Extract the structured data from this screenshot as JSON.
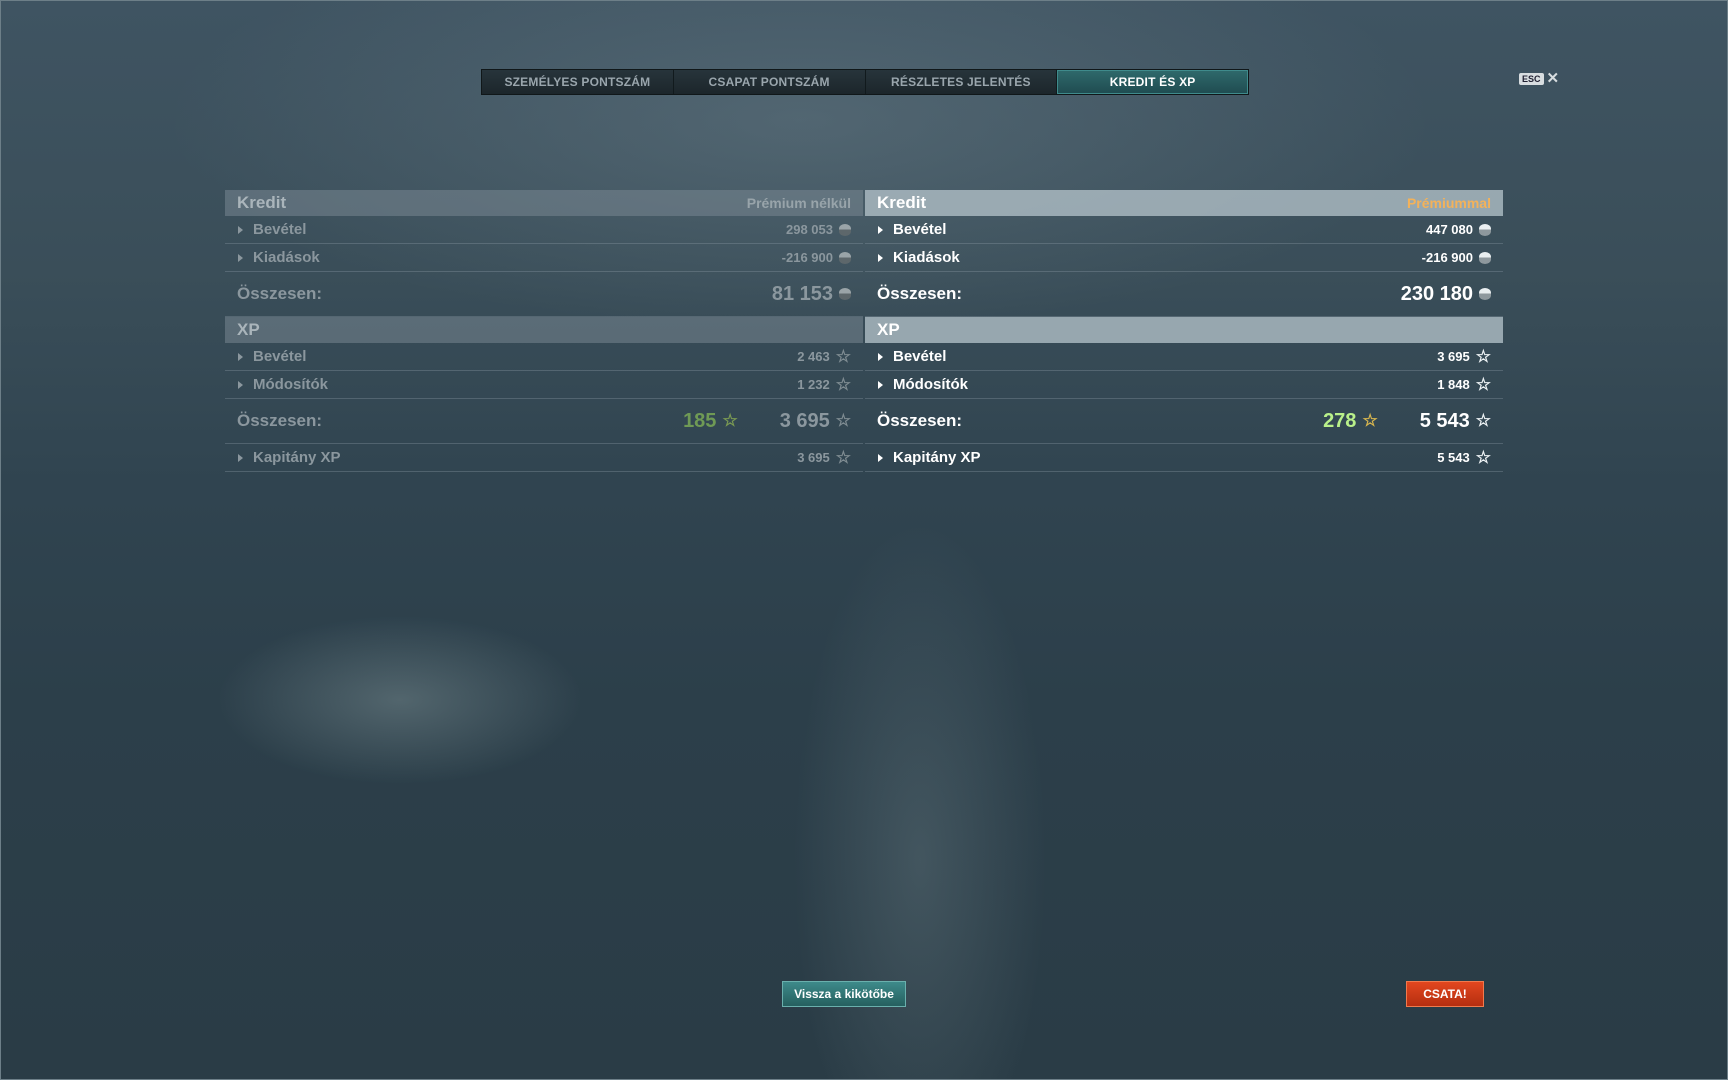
{
  "tabs": [
    {
      "label": "SZEMÉLYES PONTSZÁM"
    },
    {
      "label": "CSAPAT PONTSZÁM"
    },
    {
      "label": "RÉSZLETES JELENTÉS"
    },
    {
      "label": "KREDIT ÉS XP"
    }
  ],
  "esc": {
    "key": "ESC",
    "close": "✕"
  },
  "left": {
    "credit_title": "Kredit",
    "premium_tag": "Prémium nélkül",
    "credit_rows": [
      {
        "label": "Bevétel",
        "value": "298 053"
      },
      {
        "label": "Kiadások",
        "value": "-216 900"
      }
    ],
    "credit_total_label": "Összesen:",
    "credit_total": "81 153",
    "xp_title": "XP",
    "xp_rows": [
      {
        "label": "Bevétel",
        "value": "2 463"
      },
      {
        "label": "Módosítók",
        "value": "1 232"
      }
    ],
    "xp_total_label": "Összesen:",
    "xp_bonus": "185",
    "xp_total": "3 695",
    "captain_label": "Kapitány XP",
    "captain_value": "3 695"
  },
  "right": {
    "credit_title": "Kredit",
    "premium_tag": "Prémiummal",
    "credit_rows": [
      {
        "label": "Bevétel",
        "value": "447 080"
      },
      {
        "label": "Kiadások",
        "value": "-216 900"
      }
    ],
    "credit_total_label": "Összesen:",
    "credit_total": "230 180",
    "xp_title": "XP",
    "xp_rows": [
      {
        "label": "Bevétel",
        "value": "3 695"
      },
      {
        "label": "Módosítók",
        "value": "1 848"
      }
    ],
    "xp_total_label": "Összesen:",
    "xp_bonus": "278",
    "xp_total": "5 543",
    "captain_label": "Kapitány XP",
    "captain_value": "5 543"
  },
  "buttons": {
    "port": "Vissza a kikötőbe",
    "battle": "CSATA!"
  },
  "icons": {
    "credit": "credit-coin-icon",
    "xp": "star-icon"
  },
  "colors": {
    "active_tab": "#2f6a6c",
    "premium_tag": "#f3b25a",
    "bonus_xp": "#b9f08a",
    "battle": "#e2471f"
  }
}
